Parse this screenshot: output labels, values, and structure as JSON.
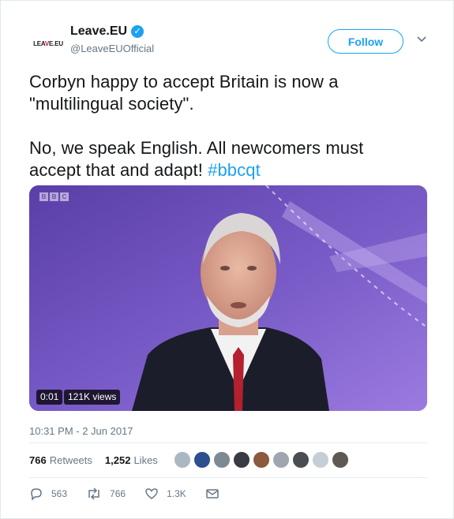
{
  "account": {
    "avatar_text_left": "LEA",
    "avatar_text_slash": "V",
    "avatar_text_right": "E.EU",
    "display_name": "Leave.EU",
    "handle": "@LeaveEUOfficial",
    "verified_icon": "verified-badge-icon"
  },
  "follow_button": {
    "label": "Follow"
  },
  "tweet": {
    "line1": "Corbyn happy to accept Britain is now a",
    "line2": "\"multilingual society\".",
    "line3": "No, we speak English. All newcomers must",
    "line4": "accept that and adapt! ",
    "hashtag": "#bbcqt"
  },
  "media": {
    "logo": [
      "B",
      "B",
      "C"
    ],
    "duration": "0:01",
    "views": "121K views"
  },
  "timestamp": "10:31 PM - 2 Jun 2017",
  "stats": {
    "retweets_count": "766",
    "retweets_label": "Retweets",
    "likes_count": "1,252",
    "likes_label": "Likes"
  },
  "actions": {
    "reply_count": "563",
    "retweet_count": "766",
    "like_count": "1.3K"
  },
  "colors": {
    "accent": "#1da1f2",
    "secondary_text": "#657786",
    "video_background": "#6a4fb3"
  }
}
